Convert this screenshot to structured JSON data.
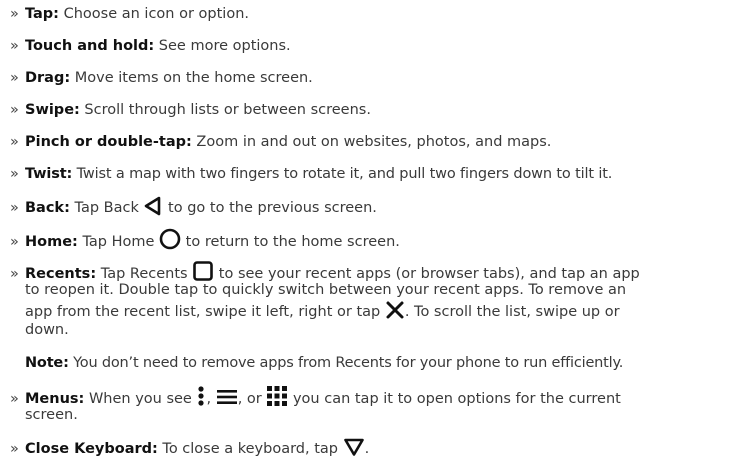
{
  "bullet": "»",
  "items": [
    {
      "label": "Tap:",
      "text": " Choose an icon or option."
    },
    {
      "label": "Touch and hold:",
      "text": " See more options."
    },
    {
      "label": "Drag:",
      "text": " Move items on the home screen."
    },
    {
      "label": "Swipe:",
      "text": " Scroll through lists or between screens."
    },
    {
      "label": "Pinch or double-tap:",
      "text": " Zoom in and out on websites, photos, and maps."
    },
    {
      "label": "Twist:",
      "text": " Twist a map with two fingers to rotate it, and pull two fingers down to tilt it."
    },
    {
      "label": "Back:",
      "pre": " Tap Back ",
      "post": " to go to the previous screen.",
      "icon": "back-triangle-icon"
    },
    {
      "label": "Home:",
      "pre": " Tap Home ",
      "post": " to return to the home screen.",
      "icon": "home-circle-icon"
    },
    {
      "label": "Recents:",
      "pre": " Tap Recents ",
      "post": " to see your recent apps (or browser tabs), and tap an app",
      "icon": "recents-square-icon",
      "line2": "to reopen it. Double tap to quickly switch between your recent apps. To remove an",
      "line3_pre": "app from the recent list, swipe it left, right or tap ",
      "line3_post": ". To scroll the list, swipe up or",
      "line3_icon": "close-x-icon",
      "line4": "down."
    }
  ],
  "note": {
    "label": "Note:",
    "text": " You don’t need to remove apps from Recents for your phone to run efficiently."
  },
  "menus": {
    "label": "Menus:",
    "pre": " When you see ",
    "sep1": ", ",
    "sep2": ", or ",
    "post": " you can tap it to open options for the current",
    "line2": "screen.",
    "icons": [
      "vertical-dots-icon",
      "hamburger-icon",
      "grid-icon"
    ]
  },
  "close_keyboard": {
    "label": "Close Keyboard:",
    "pre": " To close a keyboard, tap ",
    "post": ".",
    "icon": "close-keyboard-triangle-icon"
  }
}
